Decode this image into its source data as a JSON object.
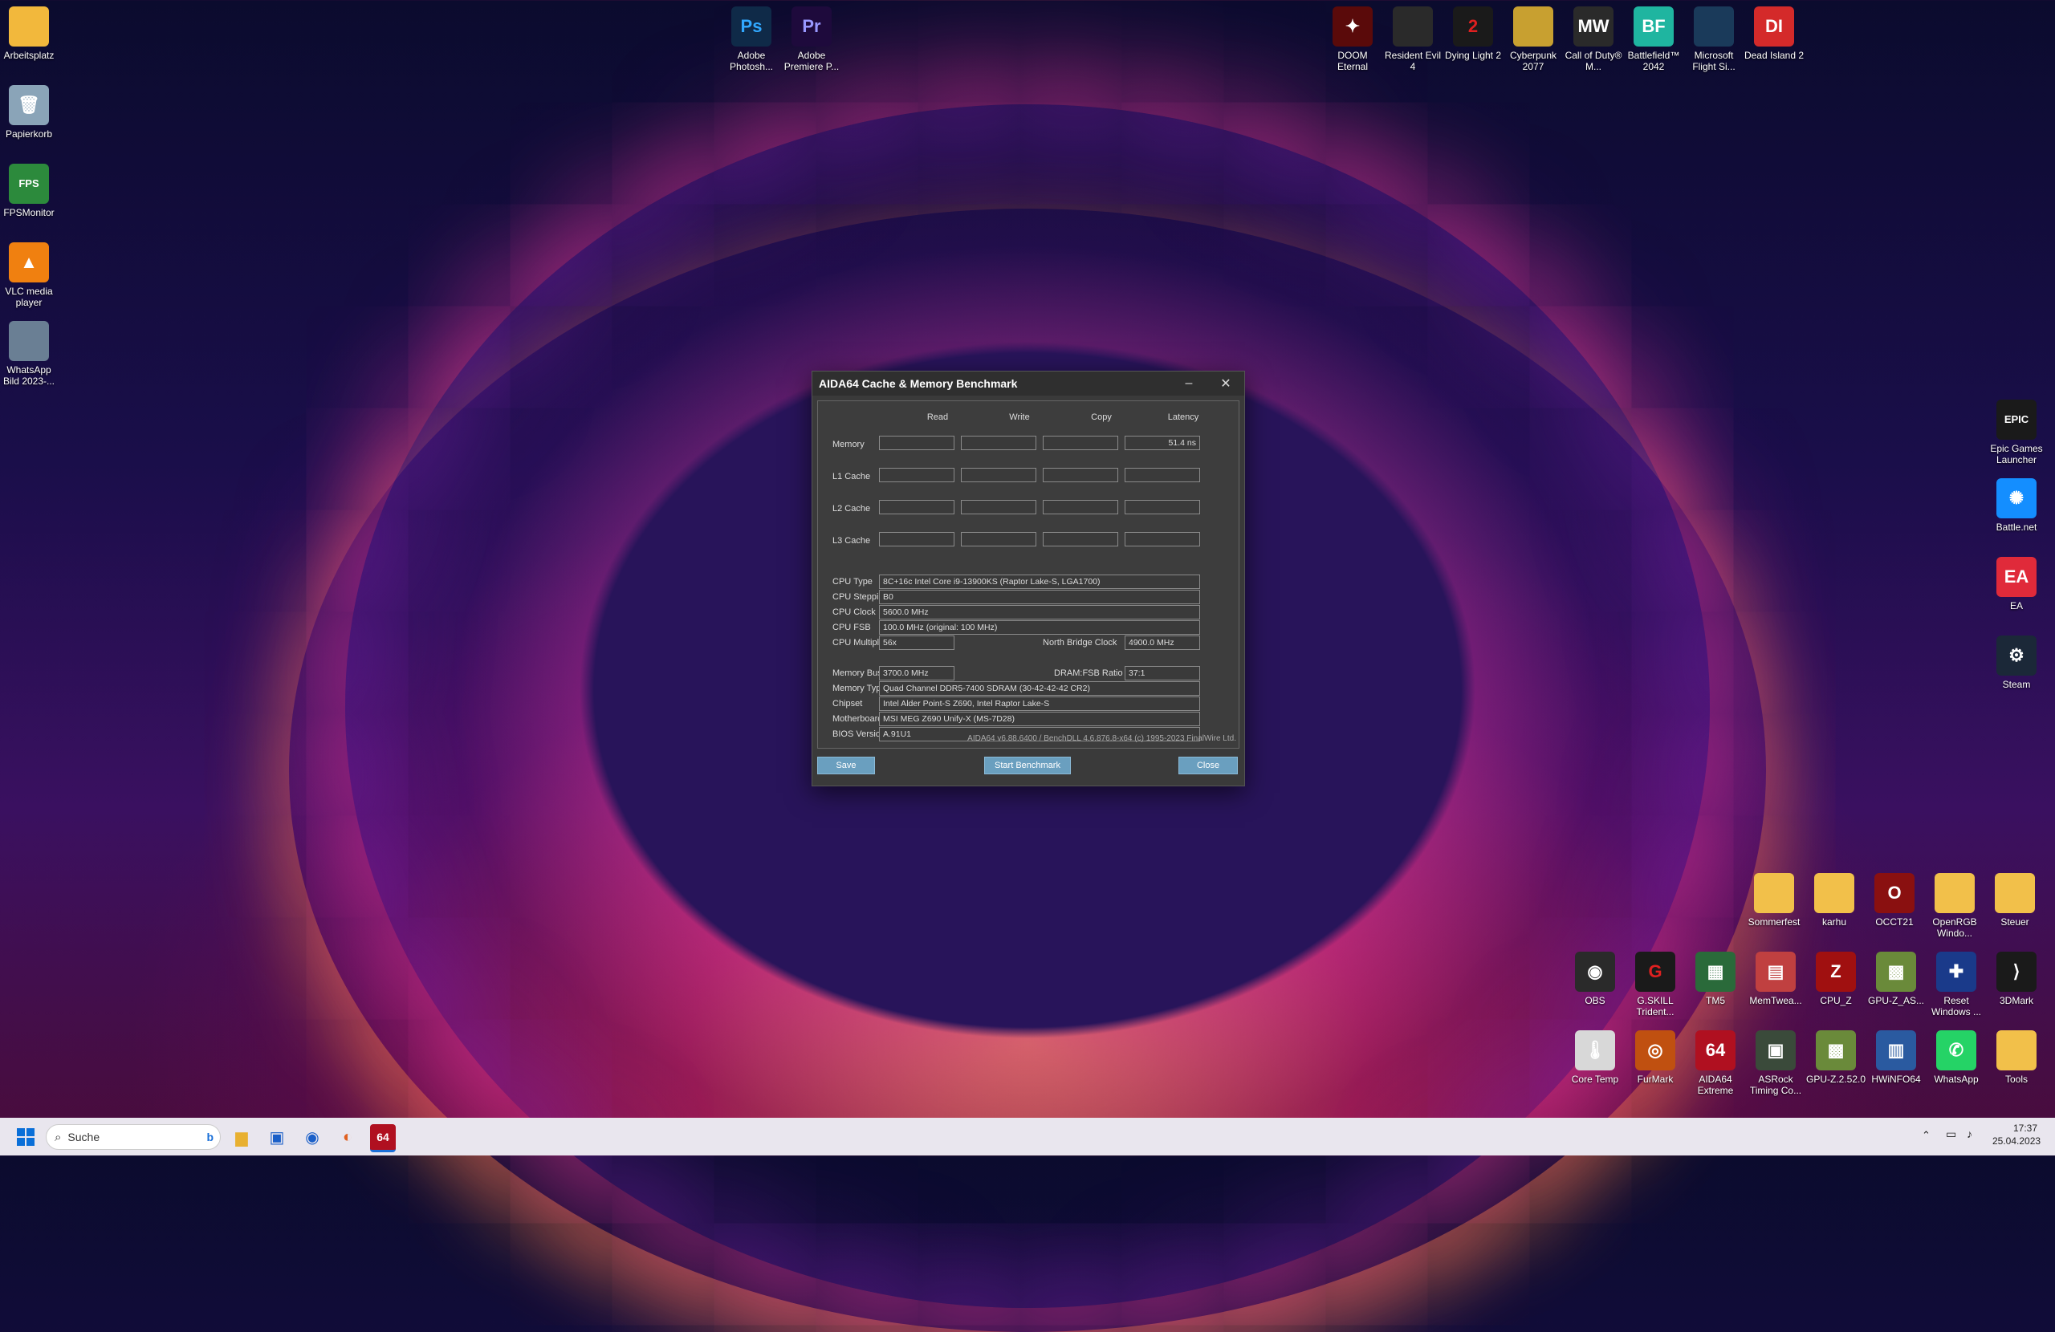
{
  "desktop_left": [
    {
      "label": "Arbeitsplatz",
      "icon": "folder-icon",
      "color": "#f2b83c",
      "glyph": ""
    },
    {
      "label": "Papierkorb",
      "icon": "recycle-bin-icon",
      "color": "#8aa4b8",
      "glyph": "🗑"
    },
    {
      "label": "FPSMonitor",
      "icon": "fpsmonitor-icon",
      "color": "#2c8a3c",
      "glyph": "FPS"
    },
    {
      "label": "VLC media player",
      "icon": "vlc-icon",
      "color": "#f08010",
      "glyph": "▲"
    },
    {
      "label": "WhatsApp Bild 2023-...",
      "icon": "image-file-icon",
      "color": "#6a7f94",
      "glyph": ""
    }
  ],
  "desktop_top_middle": [
    {
      "label": "Adobe Photosh...",
      "icon": "photoshop-icon",
      "color": "#0f2a48",
      "glyph": "Ps",
      "glyph_color": "#31a8ff"
    },
    {
      "label": "Adobe Premiere P...",
      "icon": "premiere-icon",
      "color": "#1e0a3c",
      "glyph": "Pr",
      "glyph_color": "#9999ff"
    }
  ],
  "desktop_top_right": [
    {
      "label": "DOOM Eternal",
      "icon": "doom-icon",
      "color": "#5a0a0a",
      "glyph": "✦"
    },
    {
      "label": "Resident Evil 4",
      "icon": "resident-evil-icon",
      "color": "#2a2a2a",
      "glyph": ""
    },
    {
      "label": "Dying Light 2",
      "icon": "dying-light-icon",
      "color": "#1a1a1a",
      "glyph": "2",
      "glyph_color": "#e02020"
    },
    {
      "label": "Cyberpunk 2077",
      "icon": "cyberpunk-icon",
      "color": "#c8a030",
      "glyph": ""
    },
    {
      "label": "Call of Duty® M...",
      "icon": "call-of-duty-icon",
      "color": "#2a2a2a",
      "glyph": "MW"
    },
    {
      "label": "Battlefield™ 2042",
      "icon": "battlefield-icon",
      "color": "#1fb5a0",
      "glyph": "BF"
    },
    {
      "label": "Microsoft Flight Si...",
      "icon": "flight-sim-icon",
      "color": "#1a3a5a",
      "glyph": ""
    },
    {
      "label": "Dead Island 2",
      "icon": "dead-island-icon",
      "color": "#d42a2a",
      "glyph": "DI"
    }
  ],
  "desktop_right_column": [
    {
      "label": "Epic Games Launcher",
      "icon": "epic-games-icon",
      "color": "#1a1a1a",
      "glyph": "EPIC"
    },
    {
      "label": "Battle.net",
      "icon": "battlenet-icon",
      "color": "#148eff",
      "glyph": "✺"
    },
    {
      "label": "EA",
      "icon": "ea-icon",
      "color": "#e02a3a",
      "glyph": "EA"
    },
    {
      "label": "Steam",
      "icon": "steam-icon",
      "color": "#1b2838",
      "glyph": "⚙"
    }
  ],
  "desktop_br_row1": [
    {
      "label": "Sommerfest",
      "icon": "folder-icon",
      "color": "#f2c04a",
      "glyph": ""
    },
    {
      "label": "karhu",
      "icon": "folder-icon",
      "color": "#f2c04a",
      "glyph": ""
    },
    {
      "label": "OCCT21",
      "icon": "occt-icon",
      "color": "#8a1010",
      "glyph": "O"
    },
    {
      "label": "OpenRGB Windo...",
      "icon": "folder-icon",
      "color": "#f2c04a",
      "glyph": ""
    },
    {
      "label": "Steuer",
      "icon": "folder-icon",
      "color": "#f2c04a",
      "glyph": ""
    }
  ],
  "desktop_br_row2": [
    {
      "label": "OBS",
      "icon": "obs-icon",
      "color": "#2a2a2a",
      "glyph": "◉"
    },
    {
      "label": "G.SKILL Trident...",
      "icon": "gskill-icon",
      "color": "#1a1a1a",
      "glyph": "G",
      "glyph_color": "#e02020"
    },
    {
      "label": "TM5",
      "icon": "tm5-icon",
      "color": "#2a6a3a",
      "glyph": "▦"
    },
    {
      "label": "MemTwea...",
      "icon": "memtweak-icon",
      "color": "#c04040",
      "glyph": "▤"
    },
    {
      "label": "CPU_Z",
      "icon": "cpuz-icon",
      "color": "#a01010",
      "glyph": "Z"
    },
    {
      "label": "GPU-Z_AS...",
      "icon": "gpuz-icon",
      "color": "#6a8a3a",
      "glyph": "▩"
    },
    {
      "label": "Reset Windows ...",
      "icon": "reset-windows-icon",
      "color": "#1a3a8a",
      "glyph": "✚"
    },
    {
      "label": "3DMark",
      "icon": "3dmark-icon",
      "color": "#1a1a1a",
      "glyph": "⟩"
    }
  ],
  "desktop_br_row3": [
    {
      "label": "Core Temp",
      "icon": "core-temp-icon",
      "color": "#d8d8d8",
      "glyph": "🌡"
    },
    {
      "label": "FurMark",
      "icon": "furmark-icon",
      "color": "#c05010",
      "glyph": "◎"
    },
    {
      "label": "AIDA64 Extreme",
      "icon": "aida64-icon",
      "color": "#b01020",
      "glyph": "64"
    },
    {
      "label": "ASRock Timing Co...",
      "icon": "asrock-icon",
      "color": "#3a4a3a",
      "glyph": "▣"
    },
    {
      "label": "GPU-Z.2.52.0",
      "icon": "gpuz-icon",
      "color": "#6a8a3a",
      "glyph": "▩"
    },
    {
      "label": "HWiNFO64",
      "icon": "hwinfo-icon",
      "color": "#2a5aa0",
      "glyph": "▥"
    },
    {
      "label": "WhatsApp",
      "icon": "whatsapp-icon",
      "color": "#25d366",
      "glyph": "✆"
    },
    {
      "label": "Tools",
      "icon": "folder-icon",
      "color": "#f2c04a",
      "glyph": ""
    }
  ],
  "window": {
    "title": "AIDA64 Cache & Memory Benchmark",
    "minimize": "–",
    "close": "✕",
    "columns": [
      "Read",
      "Write",
      "Copy",
      "Latency"
    ],
    "rows": [
      {
        "label": "Memory",
        "values": [
          "",
          "",
          "",
          "51.4 ns"
        ]
      },
      {
        "label": "L1 Cache",
        "values": [
          "",
          "",
          "",
          ""
        ]
      },
      {
        "label": "L2 Cache",
        "values": [
          "",
          "",
          "",
          ""
        ]
      },
      {
        "label": "L3 Cache",
        "values": [
          "",
          "",
          "",
          ""
        ]
      }
    ],
    "cpu_type_label": "CPU Type",
    "cpu_type": "8C+16c Intel Core i9-13900KS  (Raptor Lake-S, LGA1700)",
    "cpu_stepping_label": "CPU Stepping",
    "cpu_stepping": "B0",
    "cpu_clock_label": "CPU Clock",
    "cpu_clock": "5600.0 MHz",
    "cpu_fsb_label": "CPU FSB",
    "cpu_fsb": "100.0 MHz  (original: 100 MHz)",
    "cpu_mult_label": "CPU Multiplier",
    "cpu_mult": "56x",
    "nb_clock_label": "North Bridge Clock",
    "nb_clock": "4900.0 MHz",
    "mem_bus_label": "Memory Bus",
    "mem_bus": "3700.0 MHz",
    "dram_ratio_label": "DRAM:FSB Ratio",
    "dram_ratio": "37:1",
    "mem_type_label": "Memory Type",
    "mem_type": "Quad Channel DDR5-7400 SDRAM  (30-42-42-42 CR2)",
    "chipset_label": "Chipset",
    "chipset": "Intel Alder Point-S Z690, Intel Raptor Lake-S",
    "mobo_label": "Motherboard",
    "mobo": "MSI MEG Z690 Unify-X (MS-7D28)",
    "bios_label": "BIOS Version",
    "bios": "A.91U1",
    "footer": "AIDA64 v6.88.6400 / BenchDLL 4.6.876.8-x64  (c) 1995-2023 FinalWire Ltd.",
    "save": "Save",
    "start": "Start Benchmark",
    "close_btn": "Close"
  },
  "taskbar": {
    "search_placeholder": "Suche",
    "time": "17:37",
    "date": "25.04.2023"
  }
}
